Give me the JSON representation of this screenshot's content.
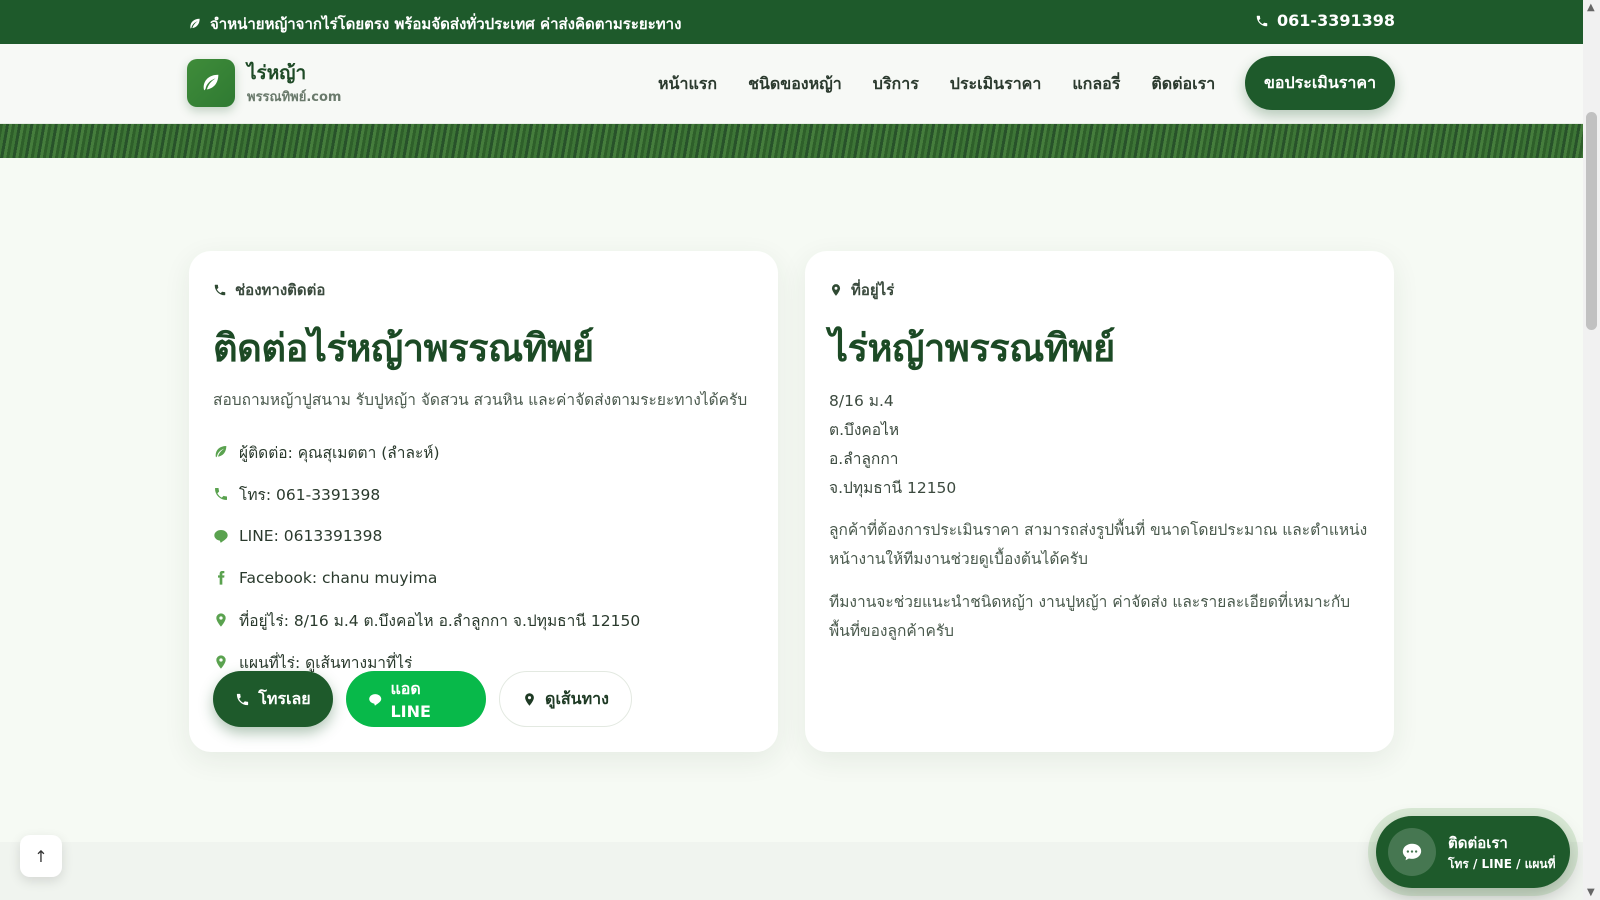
{
  "topbar": {
    "announcement": "จำหน่ายหญ้าจากไร่โดยตรง พร้อมจัดส่งทั่วประเทศ ค่าส่งคิดตามระยะทาง",
    "phone": "061-3391398"
  },
  "header": {
    "logo_title": "ไร่หญ้า",
    "logo_sub": "พรรณทิพย์.com",
    "nav": [
      "หน้าแรก",
      "ชนิดของหญ้า",
      "บริการ",
      "ประเมินราคา",
      "แกลอรี่",
      "ติดต่อเรา"
    ],
    "cta": "ขอประเมินราคา"
  },
  "contact_card": {
    "eyebrow": "ช่องทางติดต่อ",
    "title": "ติดต่อไร่หญ้าพรรณทิพย์",
    "description": "สอบถามหญ้าปูสนาม รับปูหญ้า จัดสวน สวนหิน และค่าจัดส่งตามระยะทางได้ครับ",
    "items": [
      {
        "icon": "leaf-icon",
        "text": "ผู้ติดต่อ: คุณสุเมตตา (ลำละห์)"
      },
      {
        "icon": "phone-icon",
        "text": "โทร:  061-3391398"
      },
      {
        "icon": "line-icon",
        "text": "LINE:  0613391398"
      },
      {
        "icon": "facebook-icon",
        "text": "Facebook: chanu muyima"
      },
      {
        "icon": "location-pin-icon",
        "text": "ที่อยู่ไร่: 8/16 ม.4 ต.บึงคอไห อ.ลำลูกกา จ.ปทุมธานี 12150"
      },
      {
        "icon": "location-pin-icon",
        "text": "แผนที่ไร่:  ดูเส้นทางมาที่ไร่"
      }
    ],
    "buttons": {
      "call": "โทรเลย",
      "line": "แอด LINE",
      "map": "ดูเส้นทาง"
    }
  },
  "address_card": {
    "eyebrow": "ที่อยู่ไร่",
    "title": "ไร่หญ้าพรรณทิพย์",
    "address_lines": [
      "8/16 ม.4",
      "ต.บึงคอไห",
      "อ.ลำลูกกา",
      "จ.ปทุมธานี 12150"
    ],
    "paragraph1": "ลูกค้าที่ต้องการประเมินราคา สามารถส่งรูปพื้นที่ ขนาดโดยประมาณ และตำแหน่งหน้างานให้ทีมงานช่วยดูเบื้องต้นได้ครับ",
    "paragraph2": "ทีมงานจะช่วยแนะนำชนิดหญ้า งานปูหญ้า ค่าจัดส่ง และรายละเอียดที่เหมาะกับพื้นที่ของลูกค้าครับ"
  },
  "floating_contact": {
    "title": "ติดต่อเรา",
    "subtitle": "โทร / LINE / แผนที่"
  },
  "back_to_top": "↑",
  "colors": {
    "brand_green": "#1e5a2b",
    "line_green": "#08b94a",
    "icon_green": "#5aa24f"
  }
}
